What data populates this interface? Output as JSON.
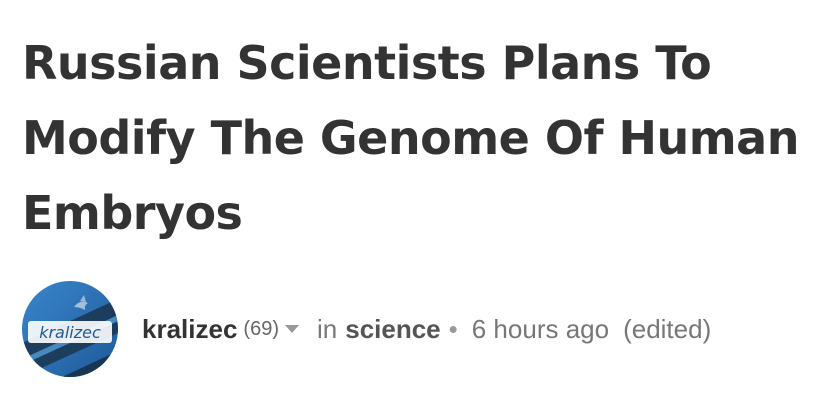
{
  "post": {
    "title": "Russian Scientists Plans To Modify The Genome Of Human Embryos",
    "author": {
      "name": "kralizec",
      "reputation": "(69)",
      "avatar_text": "kralizec",
      "menu_icon": "caret-down-icon"
    },
    "in_label": "in",
    "category": "science",
    "separator": "•",
    "time_ago": "6 hours ago",
    "edited_label": "(edited)"
  },
  "colors": {
    "title_text": "#333333",
    "meta_text": "#777777",
    "avatar_blue": "#2a6fb5",
    "avatar_dark": "#1b3550"
  }
}
